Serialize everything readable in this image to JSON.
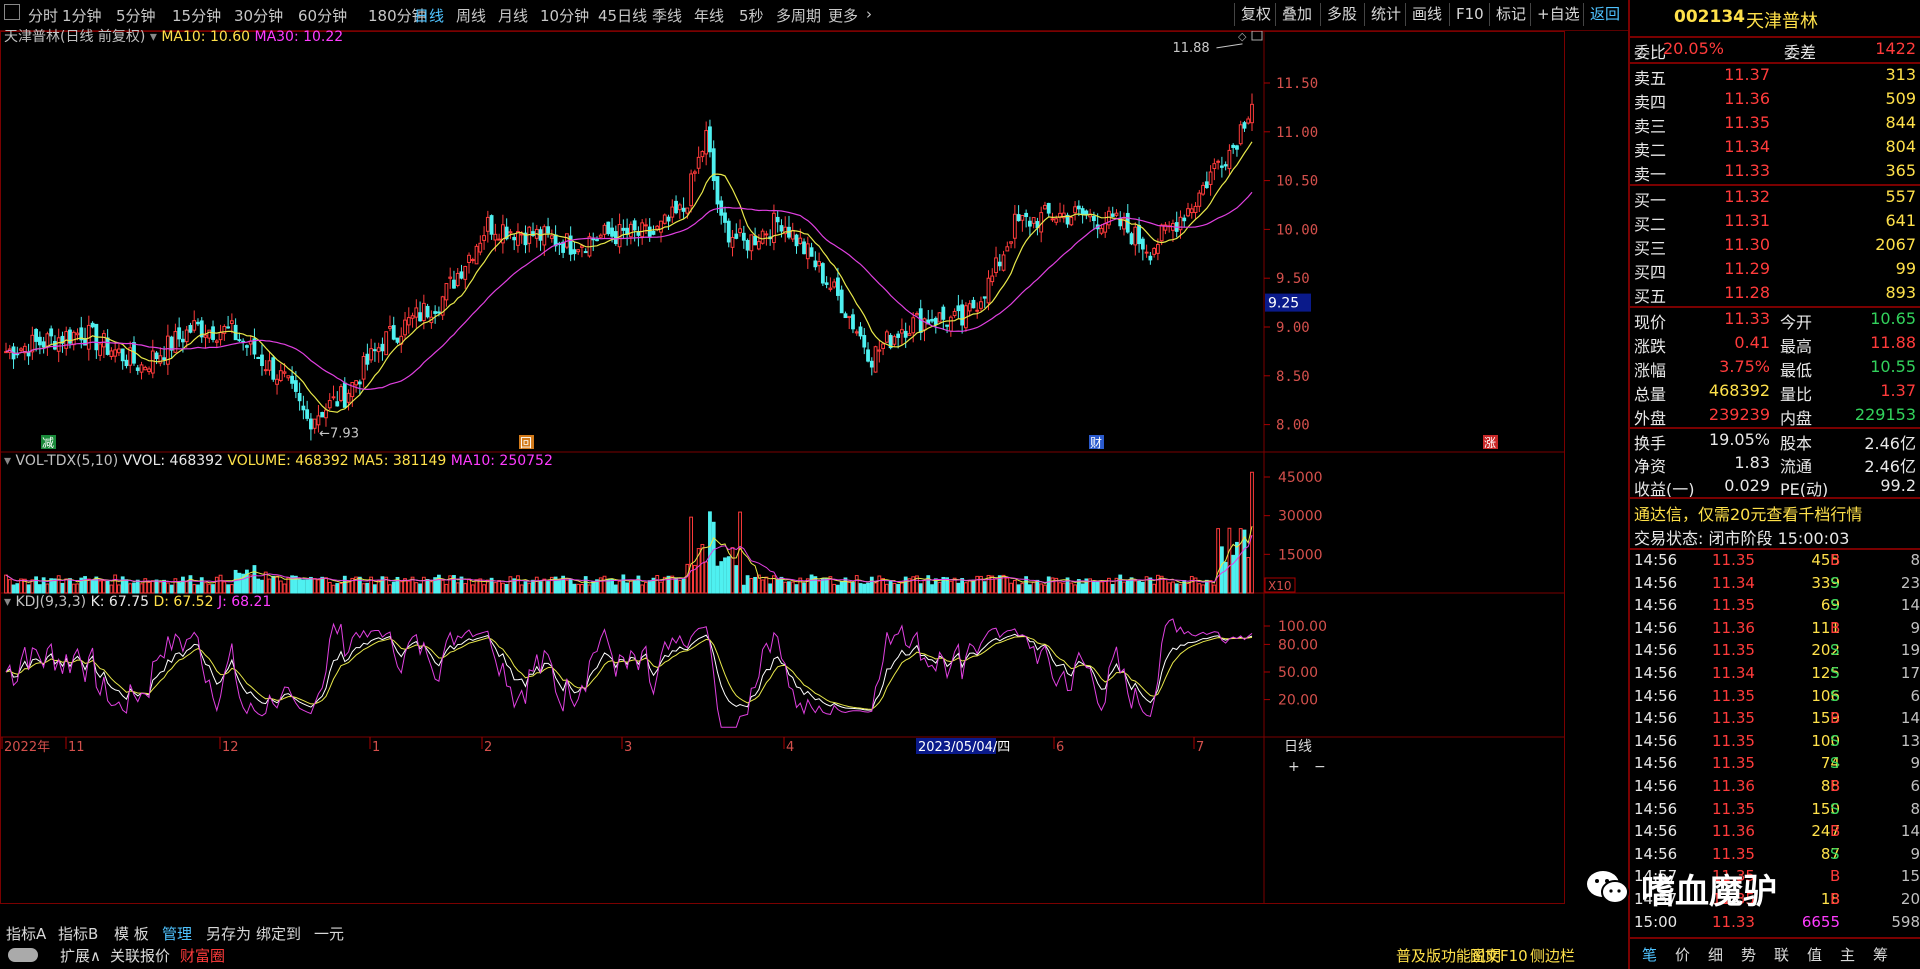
{
  "toolbar": {
    "periods": [
      "分时",
      "1分钟",
      "5分钟",
      "15分钟",
      "30分钟",
      "60分钟",
      "180分钟",
      "日线",
      "周线",
      "月线",
      "10分钟",
      "45日线",
      "季线",
      "年线",
      "5秒",
      "多周期",
      "更多"
    ],
    "active_period": "日线",
    "tools": [
      "复权",
      "叠加",
      "多股",
      "统计",
      "画线",
      "F10",
      "标记",
      "+自选",
      "返回"
    ]
  },
  "chart": {
    "price_legend": {
      "name": "天津普林(日线 前复权)",
      "ma10": "MA10: 10.60",
      "ma30": "MA30: 10.22"
    },
    "vol_legend": {
      "name": "VOL-TDX(5,10)",
      "vvol": "VVOL: 468392",
      "volume": "VOLUME: 468392",
      "ma5": "MA5: 381149",
      "ma10": "MA10: 250752"
    },
    "kdj_legend": {
      "name": "KDJ(9,3,3)",
      "k": "K: 67.75",
      "d": "D: 67.52",
      "j": "J: 68.21"
    },
    "price_ticks": [
      "11.50",
      "11.00",
      "10.50",
      "10.00",
      "9.50",
      "9.00",
      "8.50",
      "8.00"
    ],
    "price_cursor": "9.25",
    "high_marker": "11.88",
    "low_marker": "7.93",
    "vol_ticks": [
      "45000",
      "30000",
      "15000"
    ],
    "vol_unit": "X10",
    "kdj_ticks": [
      "100.00",
      "80.00",
      "50.00",
      "20.00"
    ],
    "events": [
      "减",
      "回",
      "财",
      "涨"
    ],
    "x_labels": [
      "2022年",
      "11",
      "12",
      "1",
      "2",
      "3",
      "4",
      "6",
      "7"
    ],
    "x_cursor": "2023/05/04/四",
    "x_period": "日线"
  },
  "quote": {
    "code": "002134",
    "name": "天津普林",
    "wb_label": "委比",
    "wb": "20.05%",
    "wc_label": "委差",
    "wc": "1422",
    "asks": [
      {
        "label": "卖五",
        "price": "11.37",
        "vol": "313"
      },
      {
        "label": "卖四",
        "price": "11.36",
        "vol": "509"
      },
      {
        "label": "卖三",
        "price": "11.35",
        "vol": "844"
      },
      {
        "label": "卖二",
        "price": "11.34",
        "vol": "804"
      },
      {
        "label": "卖一",
        "price": "11.33",
        "vol": "365"
      }
    ],
    "bids": [
      {
        "label": "买一",
        "price": "11.32",
        "vol": "557"
      },
      {
        "label": "买二",
        "price": "11.31",
        "vol": "641"
      },
      {
        "label": "买三",
        "price": "11.30",
        "vol": "2067"
      },
      {
        "label": "买四",
        "price": "11.29",
        "vol": "99"
      },
      {
        "label": "买五",
        "price": "11.28",
        "vol": "893"
      }
    ],
    "stats": [
      {
        "l1": "现价",
        "v1": "11.33",
        "c1": "red",
        "l2": "今开",
        "v2": "10.65",
        "c2": "green"
      },
      {
        "l1": "涨跌",
        "v1": "0.41",
        "c1": "red",
        "l2": "最高",
        "v2": "11.88",
        "c2": "red"
      },
      {
        "l1": "涨幅",
        "v1": "3.75%",
        "c1": "red",
        "l2": "最低",
        "v2": "10.55",
        "c2": "green"
      },
      {
        "l1": "总量",
        "v1": "468392",
        "c1": "yellow",
        "l2": "量比",
        "v2": "1.37",
        "c2": "red"
      },
      {
        "l1": "外盘",
        "v1": "239239",
        "c1": "red",
        "l2": "内盘",
        "v2": "229153",
        "c2": "green"
      }
    ],
    "stats2": [
      {
        "l1": "换手",
        "v1": "19.05%",
        "l2": "股本",
        "v2": "2.46亿"
      },
      {
        "l1": "净资",
        "v1": "1.83",
        "l2": "流通",
        "v2": "2.46亿"
      },
      {
        "l1": "收益(一)",
        "v1": "0.029",
        "l2": "PE(动)",
        "v2": "99.2"
      }
    ],
    "ad": "通达信，仅需20元查看千档行情",
    "trade_status": "交易状态: 闭市阶段 15:00:03",
    "ticks": [
      {
        "t": "14:56",
        "p": "11.35",
        "v": "455",
        "s": "B",
        "n": "8"
      },
      {
        "t": "14:56",
        "p": "11.34",
        "v": "339",
        "s": "S",
        "n": "23"
      },
      {
        "t": "14:56",
        "p": "11.35",
        "v": "69",
        "s": "S",
        "n": "14"
      },
      {
        "t": "14:56",
        "p": "11.36",
        "v": "111",
        "s": "B",
        "n": "9"
      },
      {
        "t": "14:56",
        "p": "11.35",
        "v": "202",
        "s": "S",
        "n": "19"
      },
      {
        "t": "14:56",
        "p": "11.34",
        "v": "125",
        "s": "S",
        "n": "17"
      },
      {
        "t": "14:56",
        "p": "11.35",
        "v": "106",
        "s": "S",
        "n": "6"
      },
      {
        "t": "14:56",
        "p": "11.35",
        "v": "159",
        "s": "B",
        "n": "14"
      },
      {
        "t": "14:56",
        "p": "11.35",
        "v": "100",
        "s": "S",
        "n": "13"
      },
      {
        "t": "14:56",
        "p": "11.35",
        "v": "74",
        "s": "S",
        "n": "9"
      },
      {
        "t": "14:56",
        "p": "11.36",
        "v": "88",
        "s": "B",
        "n": "6"
      },
      {
        "t": "14:56",
        "p": "11.35",
        "v": "150",
        "s": "S",
        "n": "8"
      },
      {
        "t": "14:56",
        "p": "11.36",
        "v": "247",
        "s": "B",
        "n": "14"
      },
      {
        "t": "14:56",
        "p": "11.35",
        "v": "87",
        "s": "S",
        "n": "9"
      },
      {
        "t": "14:57",
        "p": "11.35",
        "v": "",
        "s": "B",
        "n": "15"
      },
      {
        "t": "14:57",
        "p": "11.35",
        "v": "18",
        "s": "B",
        "n": "20"
      },
      {
        "t": "15:00",
        "p": "11.33",
        "v": "6655",
        "s": "",
        "n": "598"
      }
    ],
    "bottom_tabs": [
      "笔",
      "价",
      "细",
      "势",
      "联",
      "值",
      "主",
      "筹"
    ]
  },
  "bottombar": {
    "row1": [
      "指标A",
      "指标B",
      "模 板",
      "管理",
      "另存为",
      "绑定到",
      "一元"
    ],
    "row2": [
      "扩展∧",
      "关联报价",
      "财富圈"
    ],
    "right": [
      "普及版功能说明",
      "图文F10",
      "侧边栏"
    ]
  },
  "watermark": {
    "text": "嗜血魔驴"
  }
}
